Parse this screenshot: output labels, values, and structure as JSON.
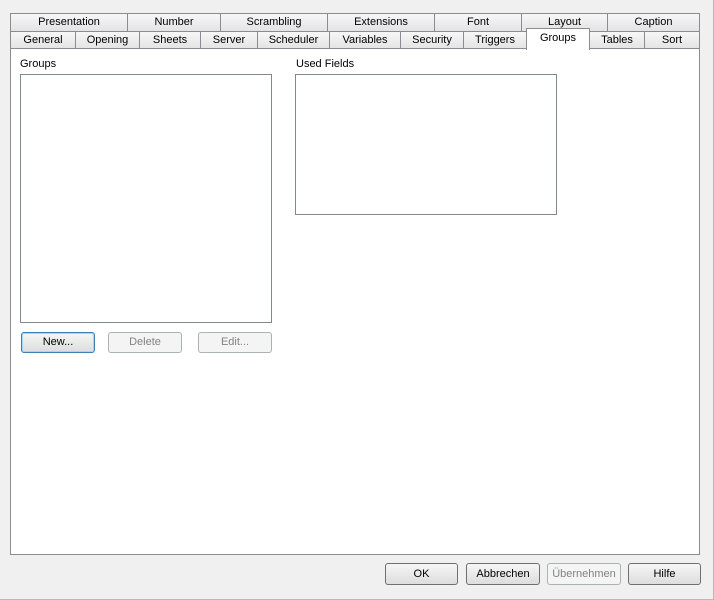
{
  "tabs": {
    "row_back": [
      "Presentation",
      "Number",
      "Scrambling",
      "Extensions",
      "Font",
      "Layout",
      "Caption"
    ],
    "row_front": [
      "General",
      "Opening",
      "Sheets",
      "Server",
      "Scheduler",
      "Variables",
      "Security",
      "Triggers",
      "Groups",
      "Tables",
      "Sort"
    ],
    "active": "Groups"
  },
  "groups_section": {
    "label": "Groups",
    "new_button": "New...",
    "delete_button": "Delete",
    "edit_button": "Edit..."
  },
  "used_fields_section": {
    "label": "Used Fields"
  },
  "footer": {
    "ok_button": "OK",
    "cancel_button": "Abbrechen",
    "apply_button": "Übernehmen",
    "help_button": "Hilfe"
  }
}
